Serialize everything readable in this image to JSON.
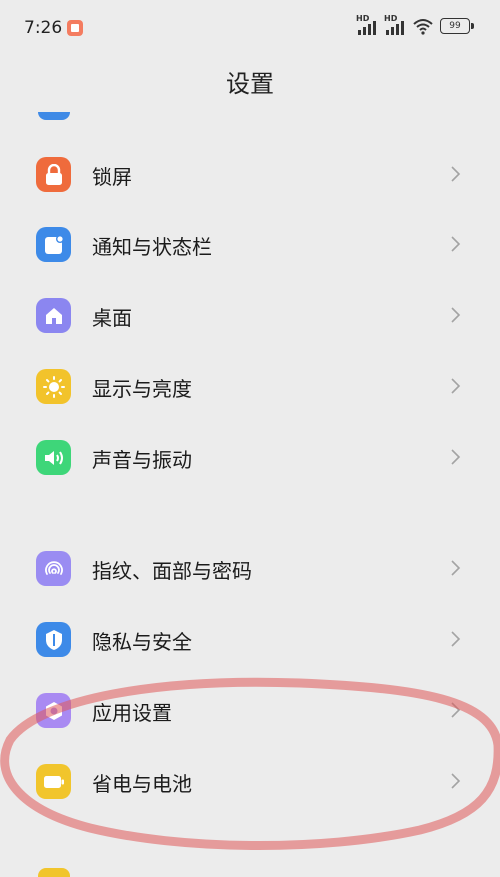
{
  "status_bar": {
    "time": "7:26",
    "signal_1": "HD",
    "signal_2": "HD",
    "battery": "99"
  },
  "header": {
    "title": "设置"
  },
  "menu": {
    "items": [
      {
        "label": "锁屏",
        "icon": "lock-icon",
        "color": "#ef6b3c"
      },
      {
        "label": "通知与状态栏",
        "icon": "notification-icon",
        "color": "#3d8ae8"
      },
      {
        "label": "桌面",
        "icon": "home-icon",
        "color": "#8b86f0"
      },
      {
        "label": "显示与亮度",
        "icon": "sun-icon",
        "color": "#f2c32b"
      },
      {
        "label": "声音与振动",
        "icon": "speaker-icon",
        "color": "#3ed679"
      },
      {
        "label": "指纹、面部与密码",
        "icon": "fingerprint-icon",
        "color": "#9a8cf2"
      },
      {
        "label": "隐私与安全",
        "icon": "shield-icon",
        "color": "#3d8ae8"
      },
      {
        "label": "应用设置",
        "icon": "app-settings-icon",
        "color": "#a98af2"
      },
      {
        "label": "省电与电池",
        "icon": "battery-icon",
        "color": "#f1c52c"
      }
    ]
  },
  "annotation": {
    "color": "#e05a5a"
  }
}
